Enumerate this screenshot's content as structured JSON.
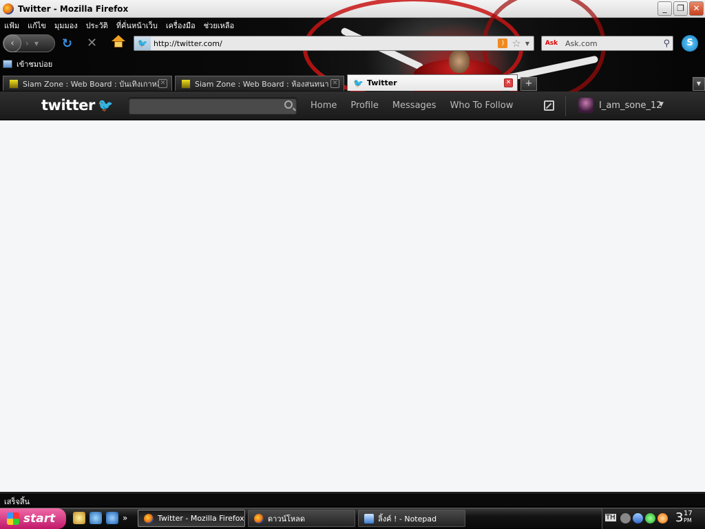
{
  "window": {
    "title": "Twitter - Mozilla Firefox"
  },
  "menubar": {
    "items": [
      "แฟ้ม",
      "แก้ไข",
      "มุมมอง",
      "ประวัติ",
      "ที่คั่นหน้าเว็บ",
      "เครื่องมือ",
      "ช่วยเหลือ"
    ]
  },
  "navbar": {
    "url": "http://twitter.com/",
    "search_placeholder": "Ask.com",
    "search_engine_icon": "ask-icon",
    "search_engine_badge": "Ask"
  },
  "bookmarks": {
    "items": [
      {
        "label": "เข้าชมบ่อย"
      }
    ]
  },
  "tabs": [
    {
      "label": "Siam Zone : Web Board : บันเทิงเกาหลี",
      "active": false
    },
    {
      "label": "Siam Zone : Web Board : ห้องสนทนา",
      "active": false
    },
    {
      "label": "Twitter",
      "active": true
    }
  ],
  "new_tab_label": "+",
  "twitter": {
    "logo_text": "twitter",
    "search_placeholder": "",
    "nav": [
      "Home",
      "Profile",
      "Messages",
      "Who To Follow"
    ],
    "username": "I_am_sone_12"
  },
  "status": {
    "text": "เสร็จสิ้น"
  },
  "taskbar": {
    "start_label": "start",
    "tasks": [
      {
        "label": "Twitter - Mozilla Firefox",
        "active": true
      },
      {
        "label": "ดาวน์โหลด",
        "active": false
      },
      {
        "label": "ลิ้งค์ ! - Notepad",
        "active": false
      }
    ],
    "tray": {
      "lang": "TH",
      "clock_hour": "3",
      "clock_min": "17",
      "clock_ampm": "PM"
    }
  },
  "colors": {
    "twitter_blue": "#33ccff",
    "topbar_bg": "#222222",
    "content_bg": "#f5f6f8",
    "start_pink": "#e0388a"
  }
}
